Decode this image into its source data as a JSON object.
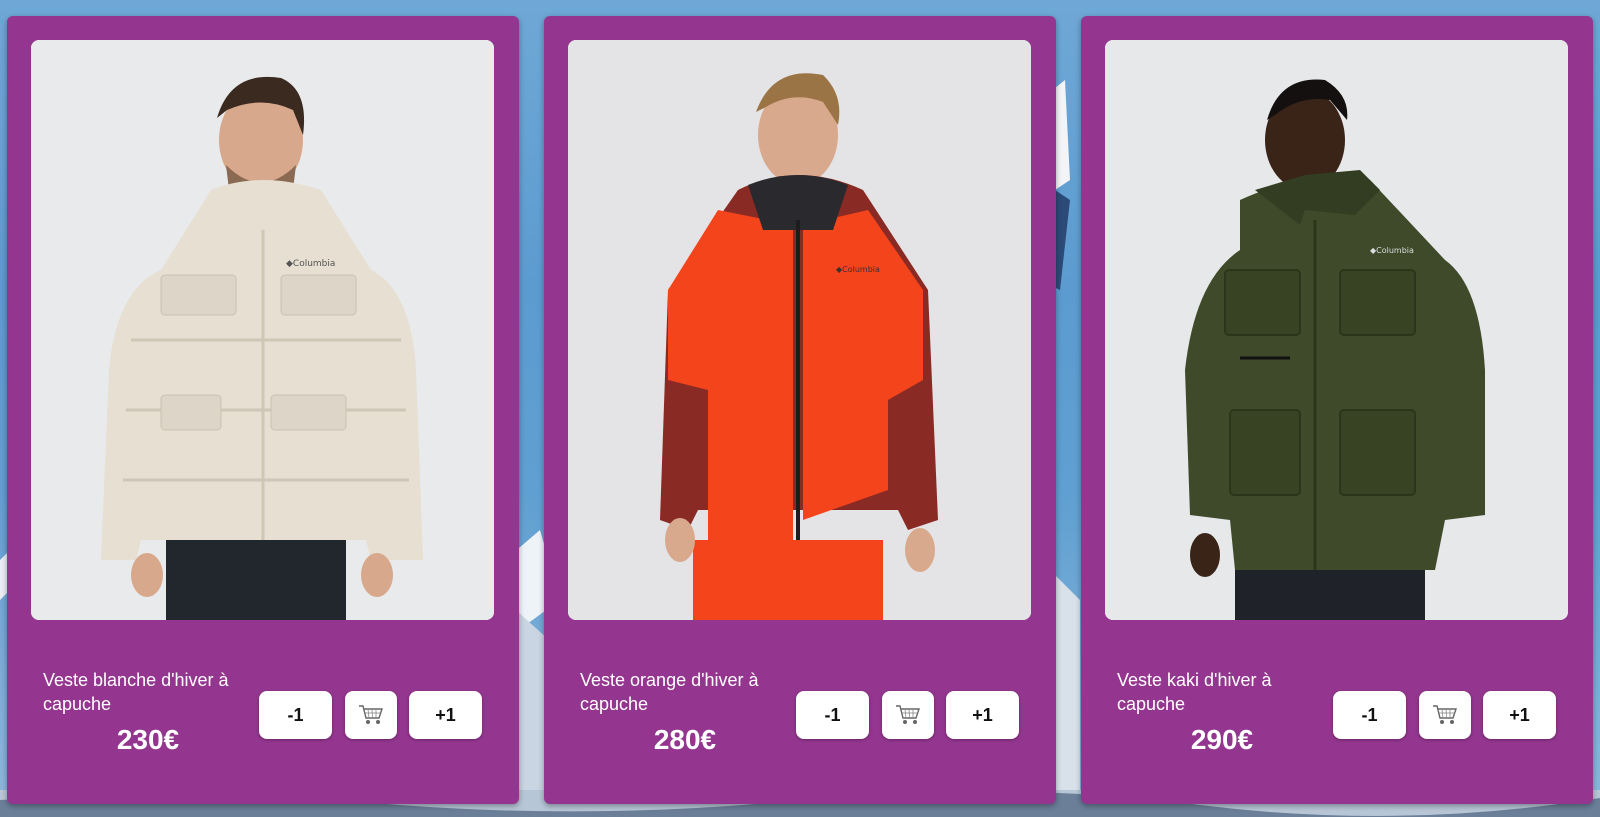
{
  "products": [
    {
      "name": "Veste blanche d'hiver à capuche",
      "price": "230€",
      "jacket_color": "#e6dfd2",
      "minus_label": "-1",
      "plus_label": "+1",
      "cart_icon": "cart-icon"
    },
    {
      "name": "Veste orange d'hiver à capuche",
      "price": "280€",
      "jacket_color": "#f4441c",
      "minus_label": "-1",
      "plus_label": "+1",
      "cart_icon": "cart-icon"
    },
    {
      "name": "Veste kaki d'hiver à capuche",
      "price": "290€",
      "jacket_color": "#3f4a2a",
      "minus_label": "-1",
      "plus_label": "+1",
      "cart_icon": "cart-icon"
    }
  ],
  "theme": {
    "card_color": "#94368f",
    "background_sky": "#5c9bd0"
  },
  "brand_label": "Columbia"
}
